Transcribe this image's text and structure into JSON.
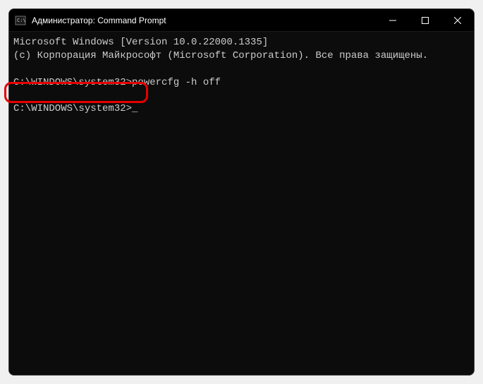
{
  "titlebar": {
    "title": "Администратор: Command Prompt"
  },
  "terminal": {
    "line1": "Microsoft Windows [Version 10.0.22000.1335]",
    "line2": "(c) Корпорация Майкрософт (Microsoft Corporation). Все права защищены.",
    "blank1": " ",
    "prompt1": "C:\\WINDOWS\\system32>",
    "command1": "powercfg -h off",
    "blank2": " ",
    "prompt2": "C:\\WINDOWS\\system32>",
    "cursor": "_"
  }
}
